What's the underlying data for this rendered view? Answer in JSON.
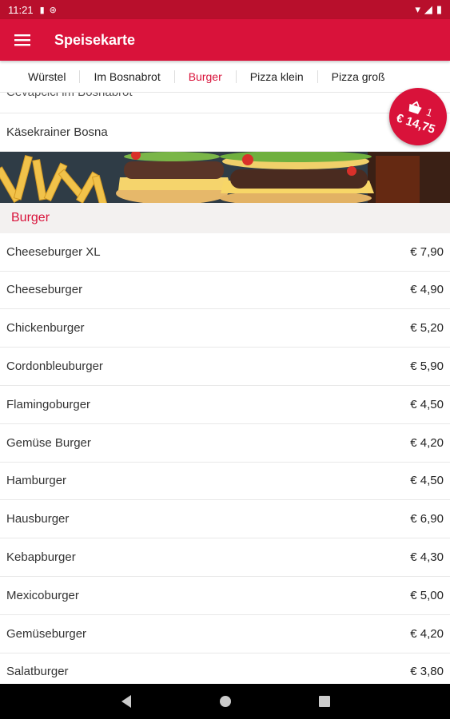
{
  "status_bar": {
    "time": "11:21"
  },
  "app_bar": {
    "title": "Speisekarte"
  },
  "tabs": [
    {
      "label": "Würstel"
    },
    {
      "label": "Im Bosnabrot"
    },
    {
      "label": "Burger",
      "active": true
    },
    {
      "label": "Pizza klein"
    },
    {
      "label": "Pizza groß"
    }
  ],
  "previous_items": [
    {
      "name": "Cevapcici im Bosnabrot"
    },
    {
      "name": "Käsekrainer Bosna"
    }
  ],
  "section": {
    "title": "Burger"
  },
  "items": [
    {
      "name": "Cheeseburger XL",
      "price": "€ 7,90"
    },
    {
      "name": "Cheeseburger",
      "price": "€ 4,90"
    },
    {
      "name": "Chickenburger",
      "price": "€ 5,20"
    },
    {
      "name": "Cordonbleuburger",
      "price": "€ 5,90"
    },
    {
      "name": "Flamingoburger",
      "price": "€ 4,50"
    },
    {
      "name": "Gemüse Burger",
      "price": "€ 4,20"
    },
    {
      "name": "Hamburger",
      "price": "€ 4,50"
    },
    {
      "name": "Hausburger",
      "price": "€ 6,90"
    },
    {
      "name": "Kebapburger",
      "price": "€ 4,30"
    },
    {
      "name": "Mexicoburger",
      "price": "€ 5,00"
    },
    {
      "name": "Gemüseburger",
      "price": "€ 4,20"
    },
    {
      "name": "Salatburger",
      "price": "€ 3,80"
    }
  ],
  "cart": {
    "count": "1",
    "total": "€ 14,75"
  },
  "colors": {
    "primary": "#d9123a",
    "status": "#b80f2c"
  }
}
